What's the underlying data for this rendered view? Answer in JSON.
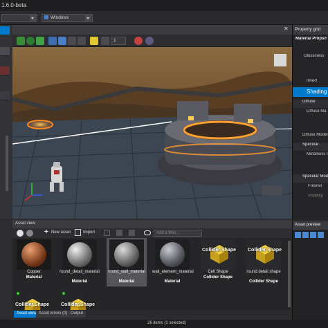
{
  "app": {
    "version_title": "1.6.0-beta"
  },
  "toolbar": {
    "platform_dropdown": "Windows"
  },
  "scene": {
    "camera_speed": "1"
  },
  "property_grid": {
    "title": "Property grid",
    "subtitle": "Material Props/r",
    "rows": [
      "Glossiness",
      "Invert",
      "Shading",
      "Diffuse",
      "Diffuse Ma",
      "Diffuse Model",
      "Specular",
      "Metalness I",
      "Specular Mod",
      "Fresnel",
      "Visibility"
    ]
  },
  "asset_view": {
    "title": "Asset view",
    "new_asset_label": "New asset",
    "import_label": "Import",
    "filter_placeholder": "Add a filter...",
    "items": [
      {
        "name": "Copper",
        "type": "Material"
      },
      {
        "name": "round_detail_material",
        "type": "Material"
      },
      {
        "name": "round_wall_material",
        "type": "Material"
      },
      {
        "name": "wall_element_material",
        "type": "Material"
      },
      {
        "name": "Cell Shape",
        "type": "Collider Shape",
        "overlay": "Collider Shape"
      },
      {
        "name": "round detail shape",
        "type": "Collider Shape",
        "overlay": "Collider Shape"
      },
      {
        "name": "",
        "type": "",
        "overlay": "Collider Shape"
      },
      {
        "name": "",
        "type": "",
        "overlay": "Collider Shape"
      }
    ]
  },
  "bottom_tabs": [
    "Asset view",
    "Asset errors (0)",
    "Output"
  ],
  "asset_preview": {
    "title": "Asset preview"
  },
  "status": {
    "text": "26 items (1 selected)"
  },
  "colors": {
    "accent": "#007acc",
    "panel": "#2d2d30",
    "collider_yellow": "#e8c020"
  }
}
